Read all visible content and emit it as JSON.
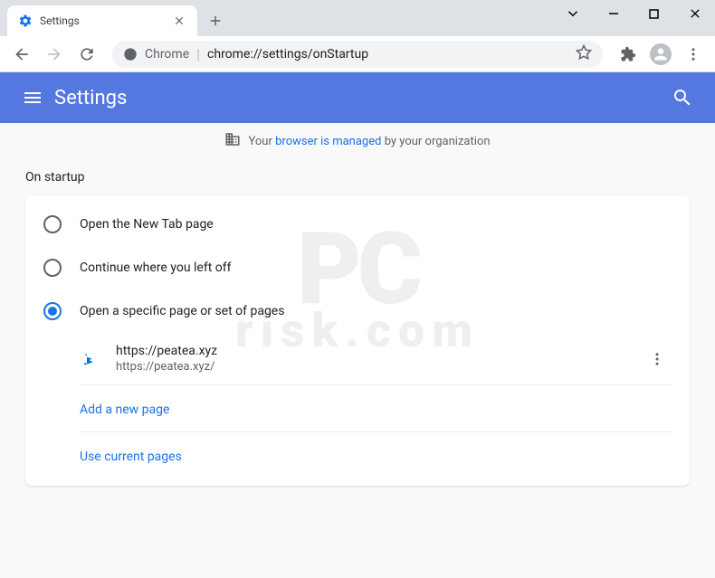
{
  "window": {
    "tab_title": "Settings"
  },
  "toolbar": {
    "url_prefix": "Chrome",
    "url": "chrome://settings/onStartup"
  },
  "header": {
    "title": "Settings"
  },
  "banner": {
    "prefix": "Your",
    "link": "browser is managed",
    "suffix": "by your organization"
  },
  "section": {
    "title": "On startup"
  },
  "radios": {
    "option1": "Open the New Tab page",
    "option2": "Continue where you left off",
    "option3": "Open a specific page or set of pages"
  },
  "pages": [
    {
      "title": "https://peatea.xyz",
      "url": "https://peatea.xyz/"
    }
  ],
  "actions": {
    "add_page": "Add a new page",
    "use_current": "Use current pages"
  },
  "watermark": {
    "line1": "PC",
    "line2": "risk.com"
  }
}
